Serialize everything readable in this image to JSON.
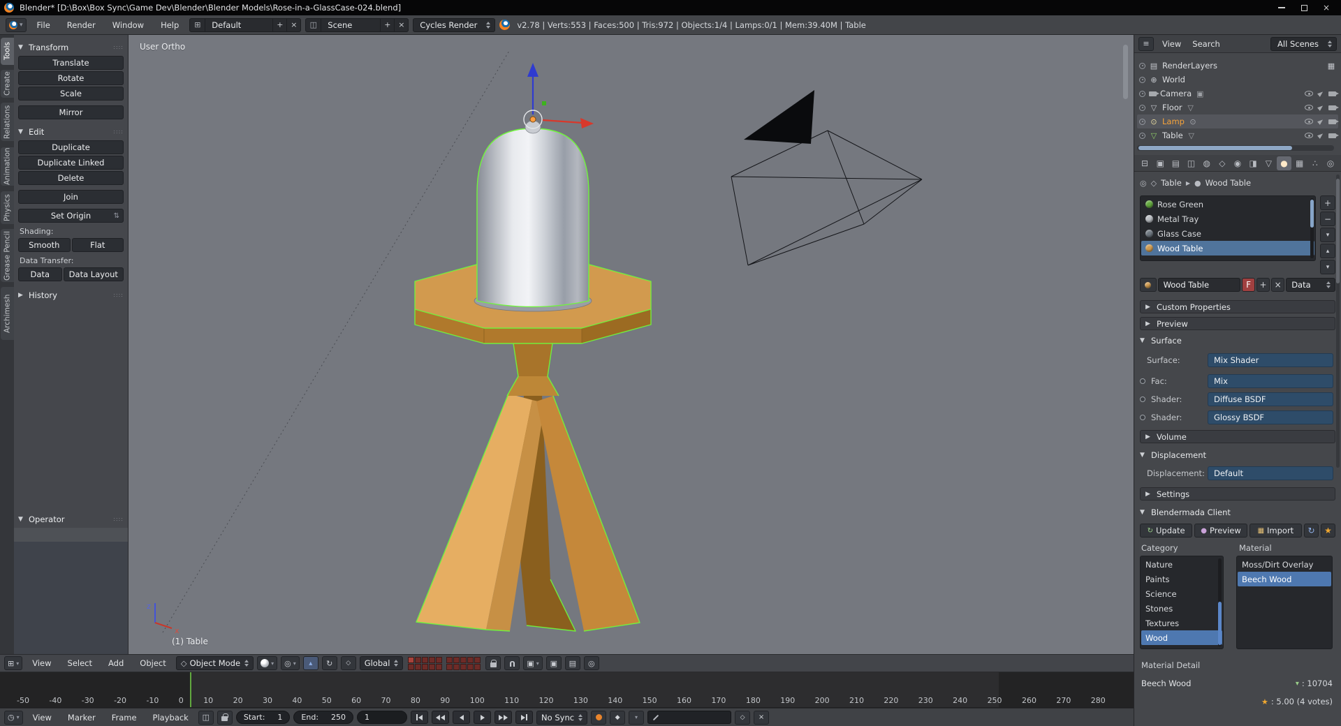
{
  "window": {
    "title": "Blender* [D:\\Box\\Box Sync\\Game Dev\\Blender\\Blender Models\\Rose-in-a-GlassCase-024.blend]"
  },
  "topbar": {
    "menus": [
      "File",
      "Render",
      "Window",
      "Help"
    ],
    "layout": "Default",
    "scene": "Scene",
    "engine": "Cycles Render",
    "stats": "v2.78 | Verts:553 | Faces:500 | Tris:972 | Objects:1/4 | Lamps:0/1 | Mem:39.40M | Table"
  },
  "tabs": [
    "Tools",
    "Create",
    "Relations",
    "Animation",
    "Physics",
    "Grease Pencil",
    "Archimesh"
  ],
  "shelf": {
    "transform": "Transform",
    "translate": "Translate",
    "rotate": "Rotate",
    "scale": "Scale",
    "mirror": "Mirror",
    "edit": "Edit",
    "duplicate": "Duplicate",
    "duplicate_linked": "Duplicate Linked",
    "delete": "Delete",
    "join": "Join",
    "set_origin": "Set Origin",
    "shading": "Shading:",
    "smooth": "Smooth",
    "flat": "Flat",
    "data_transfer": "Data Transfer:",
    "data": "Data",
    "data_layout": "Data Layout",
    "history": "History",
    "operator": "Operator"
  },
  "viewport": {
    "view": "User Ortho",
    "object": "(1) Table",
    "axis_z": "z",
    "axis_x": "x"
  },
  "vp_header": {
    "menus": [
      "View",
      "Select",
      "Add",
      "Object"
    ],
    "mode": "Object Mode",
    "orientation": "Global"
  },
  "timeline": {
    "menus": [
      "View",
      "Marker",
      "Frame",
      "Playback"
    ],
    "start_label": "Start:",
    "start": "1",
    "end_label": "End:",
    "end": "250",
    "frame": "1",
    "sync": "No Sync",
    "ticks": [
      "-50",
      "-40",
      "-30",
      "-20",
      "-10",
      "0",
      "10",
      "20",
      "30",
      "40",
      "50",
      "60",
      "70",
      "80",
      "90",
      "100",
      "110",
      "120",
      "130",
      "140",
      "150",
      "160",
      "170",
      "180",
      "190",
      "200",
      "210",
      "220",
      "230",
      "240",
      "250",
      "260",
      "270",
      "280"
    ]
  },
  "outliner": {
    "view": "View",
    "search": "Search",
    "scope": "All Scenes",
    "items": [
      {
        "label": "RenderLayers"
      },
      {
        "label": "World"
      },
      {
        "label": "Camera"
      },
      {
        "label": "Floor"
      },
      {
        "label": "Lamp",
        "selected": true
      },
      {
        "label": "Table"
      }
    ]
  },
  "props": {
    "object": "Table",
    "material": "Wood Table",
    "slots": [
      {
        "name": "Rose Green",
        "color": "#63a83e"
      },
      {
        "name": "Metal Tray",
        "color": "#b9bdc2"
      },
      {
        "name": "Glass Case",
        "color": "#6e7780"
      },
      {
        "name": "Wood Table",
        "color": "#cf9a4e",
        "selected": true
      }
    ],
    "name_value": "Wood Table",
    "fake": "F",
    "datablock": "Data",
    "custom_properties": "Custom Properties",
    "preview": "Preview",
    "surface_title": "Surface",
    "surface_label": "Surface:",
    "surface_value": "Mix Shader",
    "fac_label": "Fac:",
    "fac_value": "Mix",
    "shader1_label": "Shader:",
    "shader1_value": "Diffuse BSDF",
    "shader2_label": "Shader:",
    "shader2_value": "Glossy BSDF",
    "volume": "Volume",
    "displacement_title": "Displacement",
    "displacement_label": "Displacement:",
    "displacement_value": "Default",
    "settings": "Settings"
  },
  "bm": {
    "title": "Blendermada Client",
    "update": "Update",
    "preview": "Preview",
    "import": "Import",
    "category": "Category",
    "material": "Material",
    "categories": [
      "Nature",
      "Paints",
      "Science",
      "Stones",
      "Textures",
      "Wood"
    ],
    "selected_category": "Wood",
    "materials": [
      "Moss/Dirt Overlay",
      "Beech Wood"
    ],
    "selected_material": "Beech Wood",
    "detail": "Material Detail",
    "name": "Beech Wood",
    "downloads": ": 10704",
    "rating": ": 5.00 (4 votes)"
  },
  "icons": {
    "open": "▼",
    "closed": "▶",
    "dd": "⇅",
    "plus": "+",
    "minus": "−",
    "x": "×",
    "star": "★",
    "refresh": "↻",
    "pin": "◎",
    "mesh": "▽",
    "lamp": "⊙",
    "world": "⊕",
    "layers": "▤",
    "photo": "▦",
    "diamond": "◆",
    "diamond_open": "◇",
    "dot": "●",
    "up": "▴",
    "down": "▾",
    "editor_3d": "⊞",
    "editor_time": "◷",
    "editor_outliner": "≡",
    "editor_props": "⊟",
    "grip": "::::",
    "tab_render": "▣",
    "tab_layers": "▤",
    "tab_scene": "◫",
    "tab_world": "◍",
    "tab_object": "◇",
    "tab_constraints": "◉",
    "tab_modifiers": "◨",
    "tab_data": "▽",
    "tab_material": "●",
    "tab_texture": "▦",
    "tab_particles": "∴",
    "tab_physics": "◎",
    "magnet": "U"
  },
  "colors": {
    "selection_green": "#70f53c",
    "lamp_selected_text": "#f5a33b",
    "slot_selected_bg": "#50749c",
    "list_selected_bg": "#4e78b0",
    "enum_bg": "#2e4c69",
    "playhead_green": "#61a83f",
    "layer_tile_red": "#6e2b27"
  }
}
